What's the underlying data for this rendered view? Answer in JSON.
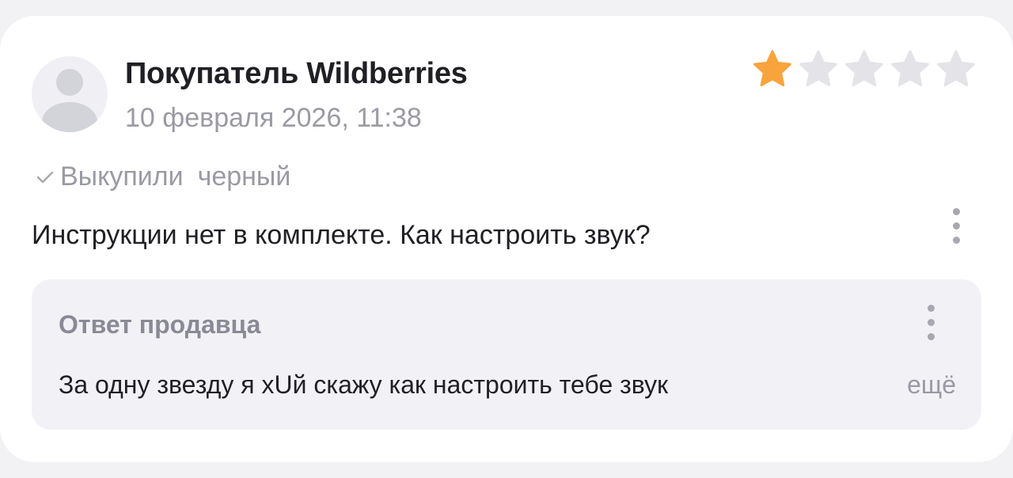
{
  "review": {
    "author": "Покупатель Wildberries",
    "date": "10 февраля 2026, 11:38",
    "rating": 1,
    "rating_max": 5,
    "status": "Выкупили",
    "variant": "черный",
    "text": "Инструкции нет в комплекте. Как настроить звук?"
  },
  "seller_reply": {
    "title": "Ответ продавца",
    "text": "За одну звезду я хUй скажу как настроить тебе звук",
    "more_label": "ещё"
  },
  "icons": {
    "avatar": "user-placeholder-icon",
    "star": "star-icon",
    "check": "check-icon",
    "menu": "more-vertical-icon"
  },
  "colors": {
    "star_filled": "#f9a33d",
    "star_empty": "#e3e3e8",
    "accent_gray": "#9a9aa4"
  }
}
